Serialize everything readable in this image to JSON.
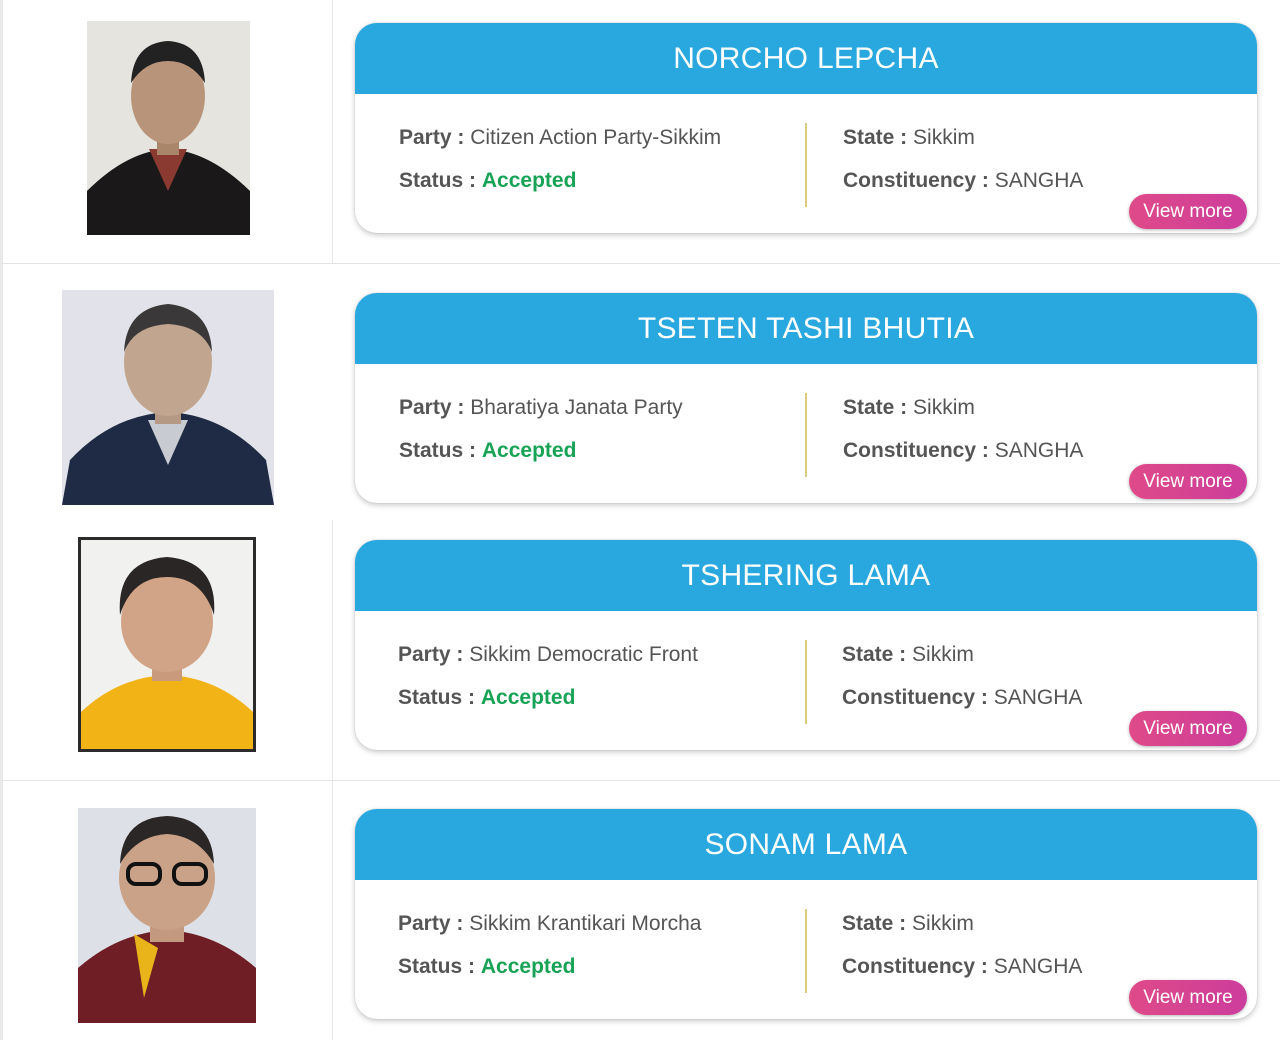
{
  "labels": {
    "party": "Party :",
    "status": "Status :",
    "state": "State :",
    "constituency": "Constituency :",
    "view_more": "View more"
  },
  "colors": {
    "header_blue": "#29a8e0",
    "accepted_green": "#17a355",
    "view_more_pink": "#df4a88"
  },
  "candidates": [
    {
      "name": "NORCHO LEPCHA",
      "party": "Citizen Action Party-Sikkim",
      "status": "Accepted",
      "state": "Sikkim",
      "constituency": "SANGHA"
    },
    {
      "name": "TSETEN TASHI BHUTIA",
      "party": "Bharatiya Janata Party",
      "status": "Accepted",
      "state": "Sikkim",
      "constituency": "SANGHA"
    },
    {
      "name": "TSHERING LAMA",
      "party": "Sikkim Democratic Front",
      "status": "Accepted",
      "state": "Sikkim",
      "constituency": "SANGHA"
    },
    {
      "name": "SONAM LAMA",
      "party": "Sikkim Krantikari Morcha",
      "status": "Accepted",
      "state": "Sikkim",
      "constituency": "SANGHA"
    }
  ]
}
